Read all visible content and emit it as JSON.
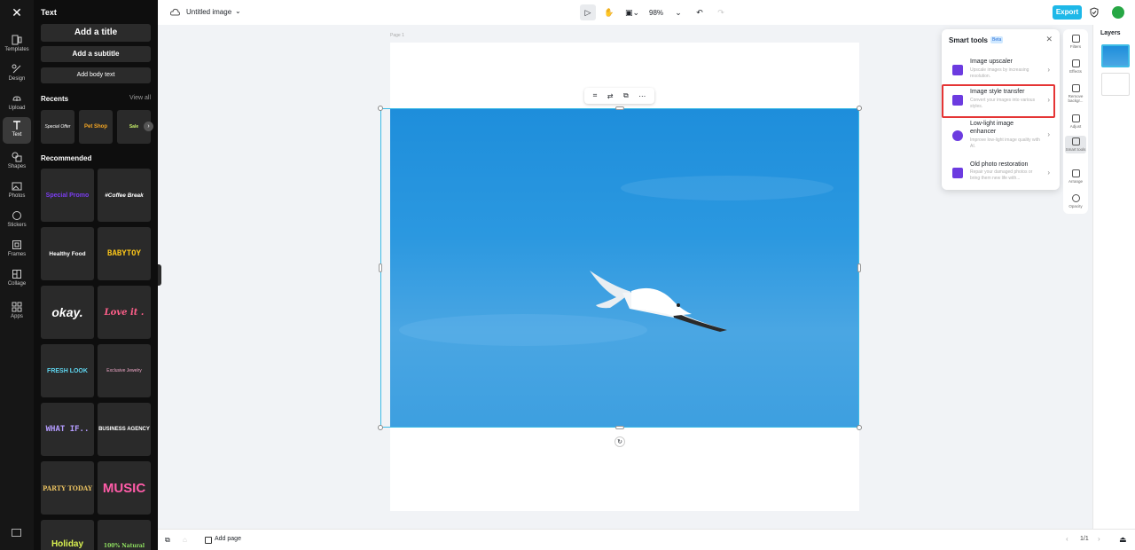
{
  "rail": {
    "items": [
      {
        "label": "Templates",
        "icon": "templates-icon"
      },
      {
        "label": "Design",
        "icon": "design-icon"
      },
      {
        "label": "Upload",
        "icon": "upload-icon"
      },
      {
        "label": "Text",
        "icon": "text-icon"
      },
      {
        "label": "Shapes",
        "icon": "shapes-icon"
      },
      {
        "label": "Photos",
        "icon": "photos-icon"
      },
      {
        "label": "Stickers",
        "icon": "stickers-icon"
      },
      {
        "label": "Frames",
        "icon": "frames-icon"
      },
      {
        "label": "Collage",
        "icon": "collage-icon"
      },
      {
        "label": "Apps",
        "icon": "apps-icon"
      }
    ],
    "active": "Text"
  },
  "panel": {
    "title": "Text",
    "add_title": "Add a title",
    "add_subtitle": "Add a subtitle",
    "add_body": "Add body text",
    "recents_heading": "Recents",
    "view_all": "View all",
    "recents": [
      "Special Offer",
      "Pet Shop",
      "Sale"
    ],
    "recommended_heading": "Recommended",
    "templates": [
      {
        "text": "Special Promo",
        "color": "#7b3df0"
      },
      {
        "text": "#Coffee Break",
        "color": "#ffffff"
      },
      {
        "text": "Healthy Food",
        "color": "#ffffff"
      },
      {
        "text": "BABYTOY",
        "color": "#f6c21a"
      },
      {
        "text": "okay.",
        "color": "#ffffff"
      },
      {
        "text": "Love it .",
        "color": "#ff5f8a"
      },
      {
        "text": "FRESH LOOK",
        "color": "#5fd6f0"
      },
      {
        "text": "Exclusive Jewelry",
        "color": "#f0a8c8"
      },
      {
        "text": "WHAT IF..",
        "color": "#b49cff"
      },
      {
        "text": "BUSINESS AGENCY",
        "color": "#ffffff"
      },
      {
        "text": "PARTY TODAY",
        "color": "#e8c060"
      },
      {
        "text": "MUSIC",
        "color": "#ff5ca8"
      },
      {
        "text": "Holiday",
        "color": "#d8f050"
      },
      {
        "text": "100% Natural",
        "color": "#8fe060"
      }
    ]
  },
  "topbar": {
    "doc_title": "Untitled image",
    "zoom": "98%",
    "export_label": "Export"
  },
  "canvas": {
    "page_label": "Page 1"
  },
  "smart_tools": {
    "title": "Smart tools",
    "beta": "Beta",
    "items": [
      {
        "title": "Image upscaler",
        "desc": "Upscale images by increasing resolution."
      },
      {
        "title": "Image style transfer",
        "desc": "Convert your images into various styles."
      },
      {
        "title": "Low-light image enhancer",
        "desc": "Improve low-light image quality with AI."
      },
      {
        "title": "Old photo restoration",
        "desc": "Repair your damaged photos or bring them new life with..."
      }
    ]
  },
  "right_tools": [
    {
      "label": "Filters"
    },
    {
      "label": "Effects"
    },
    {
      "label": "Remove backgr..."
    },
    {
      "label": "Adjust"
    },
    {
      "label": "Smart tools"
    },
    {
      "label": "Arrange"
    },
    {
      "label": "Opacity"
    }
  ],
  "layers": {
    "title": "Layers"
  },
  "bottombar": {
    "add_page": "Add page",
    "pager": "1/1"
  },
  "colors": {
    "accent": "#1eb8e8",
    "highlight": "#e53535",
    "smart_icon": "#6c3be0"
  }
}
